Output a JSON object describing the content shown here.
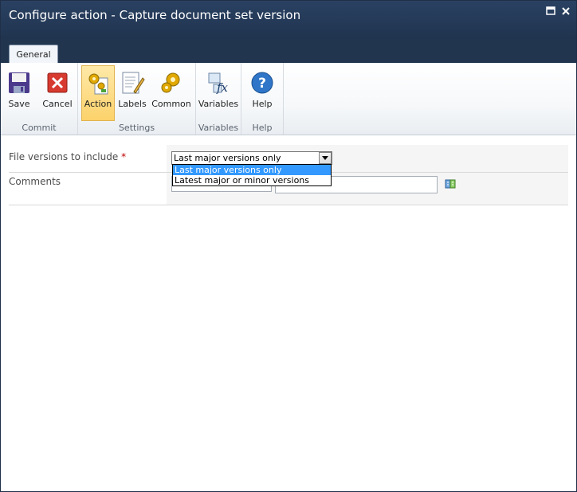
{
  "window": {
    "title": "Configure action - Capture document set version"
  },
  "ribbon": {
    "tab": "General",
    "groups": {
      "commit": {
        "label": "Commit",
        "buttons": {
          "save": "Save",
          "cancel": "Cancel"
        }
      },
      "settings": {
        "label": "Settings",
        "buttons": {
          "action": "Action",
          "labels": "Labels",
          "common": "Common"
        }
      },
      "variables": {
        "label": "Variables",
        "buttons": {
          "variables": "Variables"
        }
      },
      "help": {
        "label": "Help",
        "buttons": {
          "help": "Help"
        }
      }
    }
  },
  "form": {
    "file_versions": {
      "label": "File versions to include",
      "required_mark": "*",
      "selected": "Last major versions only",
      "options": [
        "Last major versions only",
        "Latest major or minor versions"
      ]
    },
    "comments": {
      "label": "Comments",
      "value": ""
    }
  },
  "icons": {
    "save": "save-floppy-icon",
    "cancel": "cancel-x-icon",
    "action": "gears-document-icon",
    "labels": "labels-pencil-icon",
    "common": "gears-icon",
    "variables": "fx-variables-icon",
    "help": "help-question-icon",
    "insert_reference": "insert-reference-icon"
  }
}
